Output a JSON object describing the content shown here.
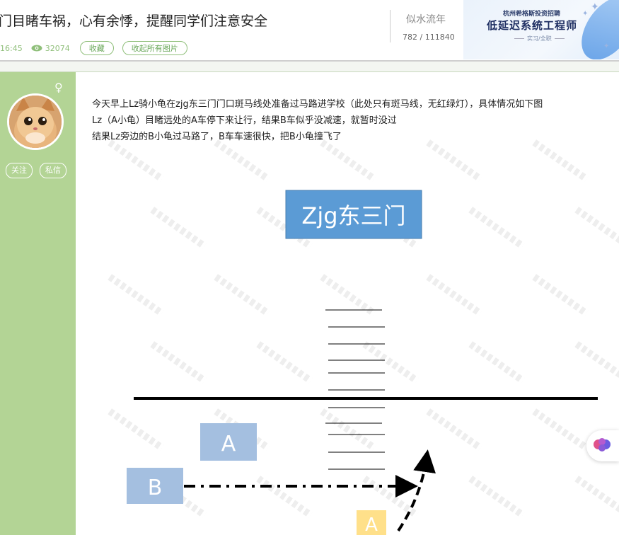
{
  "thread": {
    "title": "门目睹车祸，心有余悸，提醒同学们注意安全",
    "time": "16:45",
    "views": "32074",
    "favorite_label": "收藏",
    "collapse_images_label": "收起所有图片"
  },
  "author": {
    "name": "似水流年",
    "reply_stats": "782 / 111840",
    "follow_label": "关注",
    "message_label": "私信",
    "gender_symbol": "♀"
  },
  "ad": {
    "company": "杭州希格斯投资招聘",
    "job_title": "低延迟系统工程师",
    "subtitle": "实习/全职"
  },
  "post": {
    "lines": [
      "今天早上Lz骑小龟在zjg东三门门口斑马线处准备过马路进学校（此处只有斑马线，无红绿灯），具体情况如下图",
      "Lz（A小龟）目睹远处的A车停下来让行，结果B车似乎没减速，就暂时没过",
      "结果Lz旁边的B小龟过马路了，B车车速很快，把B小龟撞飞了"
    ]
  },
  "diagram": {
    "gate_label": "Zjg东三门",
    "car_a_label": "A",
    "car_b_label": "B",
    "scooter_a_label": "A",
    "colors": {
      "gate": "#5b9bd5",
      "car": "#a4bfe0",
      "scooter": "#ffe08a",
      "road": "#000000"
    }
  },
  "colors": {
    "sidebar": "#b3d495",
    "accent": "#8fbf7a"
  }
}
